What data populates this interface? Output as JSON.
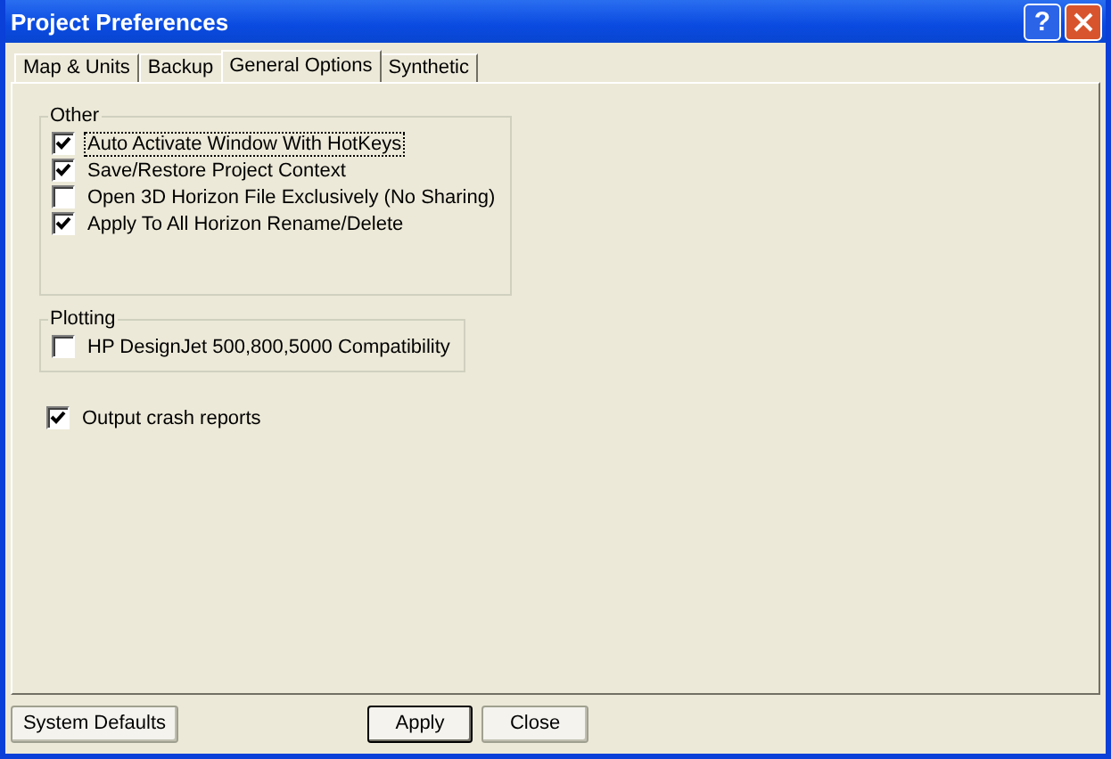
{
  "window": {
    "title": "Project Preferences",
    "help_button": "?"
  },
  "tabs": [
    {
      "label": "Map & Units",
      "selected": false
    },
    {
      "label": "Backup",
      "selected": false
    },
    {
      "label": "General Options",
      "selected": true
    },
    {
      "label": "Synthetic",
      "selected": false
    }
  ],
  "groups": [
    {
      "title": "Other",
      "items": [
        {
          "label": "Auto Activate Window With HotKeys",
          "checked": true,
          "focused": true
        },
        {
          "label": "Save/Restore Project Context",
          "checked": true,
          "focused": false
        },
        {
          "label": "Open 3D Horizon File Exclusively (No Sharing)",
          "checked": false,
          "focused": false
        },
        {
          "label": "Apply To All Horizon Rename/Delete",
          "checked": true,
          "focused": false
        }
      ]
    },
    {
      "title": "Plotting",
      "items": [
        {
          "label": "HP DesignJet 500,800,5000 Compatibility",
          "checked": false,
          "focused": false
        }
      ]
    }
  ],
  "options": [
    {
      "label": "Output crash reports",
      "checked": true,
      "focused": false
    }
  ],
  "buttons": [
    {
      "label": "System Defaults",
      "default": false
    },
    {
      "label": "Apply",
      "default": true
    },
    {
      "label": "Close",
      "default": false
    }
  ]
}
